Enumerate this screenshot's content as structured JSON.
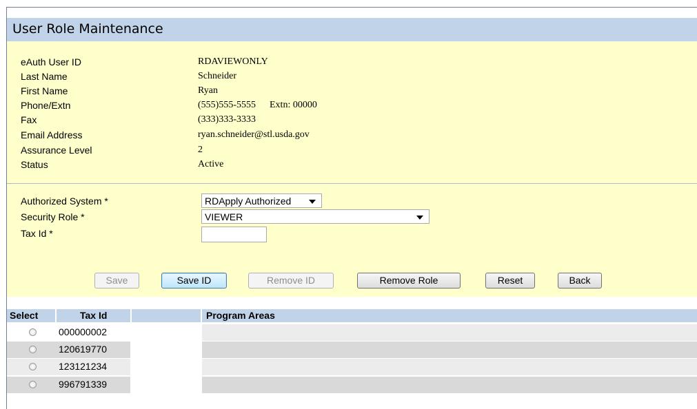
{
  "title": "User Role Maintenance",
  "user_info": [
    {
      "label": "eAuth User ID",
      "value": "RDAVIEWONLY"
    },
    {
      "label": "Last Name",
      "value": "Schneider"
    },
    {
      "label": "First Name",
      "value": "Ryan"
    },
    {
      "label": "Phone/Extn",
      "value": "(555)555-5555"
    },
    {
      "label": "Fax",
      "value": "(333)333-3333"
    },
    {
      "label": "Email Address",
      "value": "ryan.schneider@stl.usda.gov"
    },
    {
      "label": "Assurance Level",
      "value": "2"
    },
    {
      "label": "Status",
      "value": "Active"
    }
  ],
  "extension": "Extn: 00000",
  "form": {
    "authorized_system_label": "Authorized System *",
    "authorized_system_value": "RDApply Authorized",
    "security_role_label": "Security Role *",
    "security_role_value": "VIEWER",
    "tax_id_label": "Tax Id *",
    "tax_id_value": ""
  },
  "buttons": {
    "save": "Save",
    "save_id": "Save ID",
    "remove_id": "Remove ID",
    "remove_role": "Remove Role",
    "reset": "Reset",
    "back": "Back"
  },
  "table": {
    "headers": [
      "Select",
      "Tax Id",
      "",
      "Program Areas"
    ],
    "rows": [
      {
        "tax_id": "000000002",
        "program_areas": ""
      },
      {
        "tax_id": "120619770",
        "program_areas": ""
      },
      {
        "tax_id": "123121234",
        "program_areas": ""
      },
      {
        "tax_id": "996791339",
        "program_areas": ""
      }
    ]
  },
  "colors": {
    "header_blue": "#c1d3e9",
    "panel_yellow": "#ffffcc",
    "row_light": "#ececec",
    "row_dark": "#d9d9d9"
  }
}
